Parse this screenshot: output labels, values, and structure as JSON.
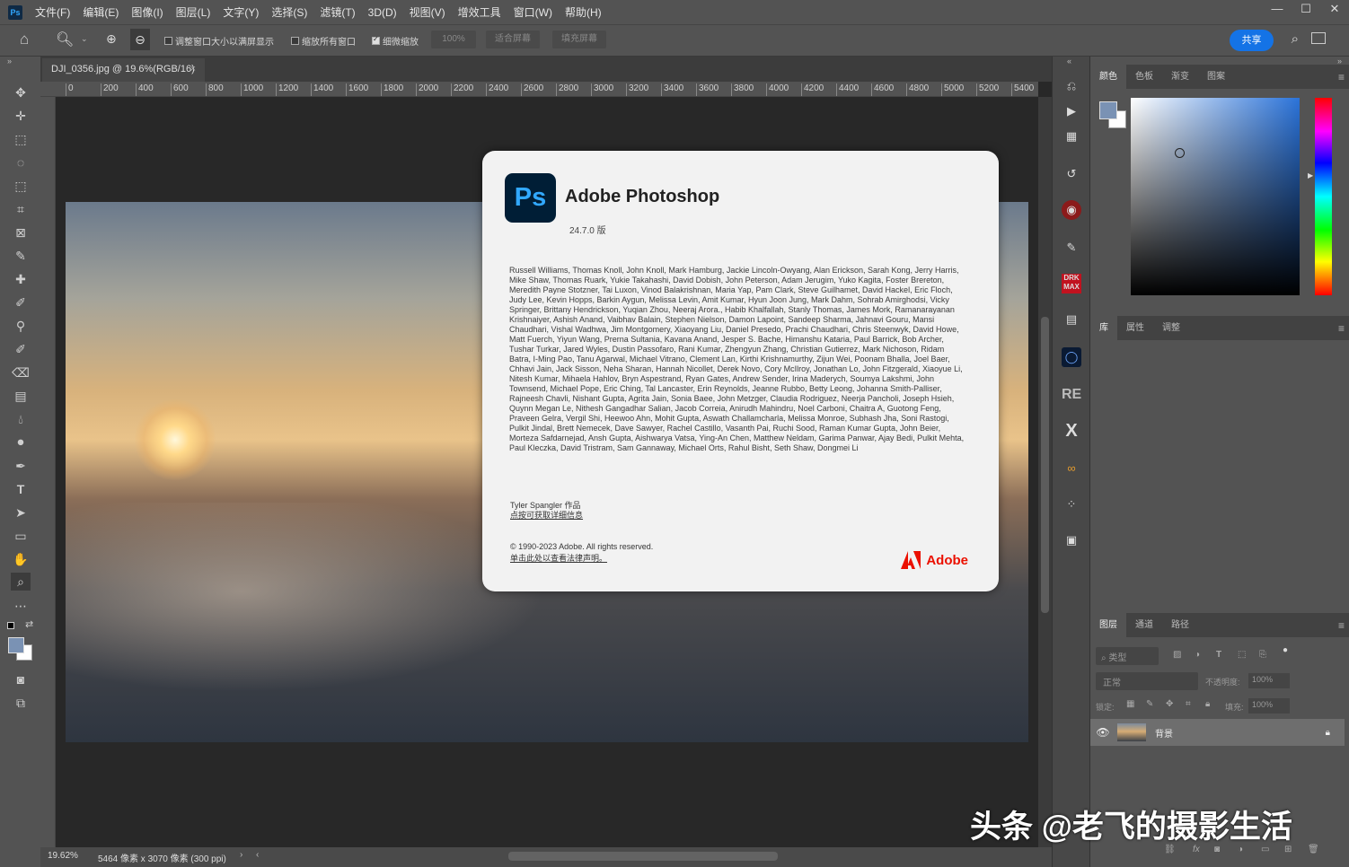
{
  "menubar": {
    "app_icon": "Ps",
    "items": [
      "文件(F)",
      "编辑(E)",
      "图像(I)",
      "图层(L)",
      "文字(Y)",
      "选择(S)",
      "滤镜(T)",
      "3D(D)",
      "视图(V)",
      "增效工具",
      "窗口(W)",
      "帮助(H)"
    ],
    "win_min": "—",
    "win_max": "☐",
    "win_close": "✕"
  },
  "options": {
    "fit_windows": "调整窗口大小以满屏显示",
    "zoom_all": "缩放所有窗口",
    "scrubby": "细微缩放",
    "zoom_value": "100%",
    "fit_screen": "适合屏幕",
    "fill_screen": "填充屏幕",
    "share": "共享"
  },
  "document": {
    "tab_title": "DJI_0356.jpg @ 19.6%(RGB/16)",
    "tab_close": "×",
    "zoom": "19.62%",
    "dimensions": "5464 像素 x 3070 像素 (300 ppi)",
    "ruler_labels": [
      "0",
      "200",
      "400",
      "600",
      "800",
      "1000",
      "1200",
      "1400",
      "1600",
      "1800",
      "2000",
      "2200",
      "2400",
      "2600",
      "2800",
      "3000",
      "3200",
      "3400",
      "3600",
      "3800",
      "4000",
      "4200",
      "4400",
      "4600",
      "4800",
      "5000",
      "5200",
      "5400"
    ]
  },
  "panels": {
    "color_tabs": [
      "颜色",
      "色板",
      "渐变",
      "图案"
    ],
    "lib_tabs": [
      "库",
      "属性",
      "调整"
    ],
    "layer_tabs": [
      "图层",
      "通道",
      "路径"
    ],
    "filter_kind": "类型",
    "blend_mode": "正常",
    "opacity_label": "不透明度:",
    "opacity_value": "100%",
    "lock_label": "锁定:",
    "fill_label": "填充:",
    "fill_value": "100%",
    "layer_name": "背景"
  },
  "about": {
    "title": "Adobe Photoshop",
    "version": "24.7.0 版",
    "credits": "Russell Williams, Thomas Knoll, John Knoll, Mark Hamburg, Jackie Lincoln-Owyang, Alan Erickson, Sarah Kong, Jerry Harris, Mike Shaw, Thomas Ruark, Yukie Takahashi, David Dobish, John Peterson, Adam Jerugim, Yuko Kagita, Foster Brereton, Meredith Payne Stotzner, Tai Luxon, Vinod Balakrishnan, Maria Yap, Pam Clark, Steve Guilhamet, David Hackel, Eric Floch, Judy Lee, Kevin Hopps, Barkin Aygun, Melissa Levin, Amit Kumar, Hyun Joon Jung, Mark Dahm, Sohrab Amirghodsi, Vicky Springer, Brittany Hendrickson, Yuqian Zhou, Neeraj Arora., Habib Khalfallah, Stanly Thomas, James Mork, Ramanarayanan Krishnaiyer, Ashish Anand, Vaibhav Balain, Stephen Nielson, Damon Lapoint, Sandeep Sharma, Jahnavi Gouru, Mansi Chaudhari, Vishal Wadhwa, Jim Montgomery, Xiaoyang Liu, Daniel Presedo, Prachi Chaudhari, Chris Steenwyk, David Howe, Matt Fuerch, Yiyun Wang, Prerna Sultania, Kavana Anand, Jesper S. Bache, Himanshu Kataria, Paul Barrick, Bob Archer, Tushar Turkar, Jared Wyles, Dustin Passofaro, Rani Kumar, Zhengyun Zhang, Christian Gutierrez, Mark Nichoson, Ridam Batra, I-Ming Pao, Tanu Agarwal, Michael Vitrano, Clement Lan, Kirthi Krishnamurthy, Zijun Wei, Poonam Bhalla, Joel Baer, Chhavi Jain, Jack Sisson, Neha Sharan, Hannah Nicollet, Derek Novo, Cory McIlroy, Jonathan Lo, John Fitzgerald, Xiaoyue Li, Nitesh Kumar, Mihaela Hahlov, Bryn Aspestrand, Ryan Gates, Andrew Sender, Irina Maderych, Soumya Lakshmi, John Townsend, Michael Pope, Eric Ching, Tal Lancaster, Erin Reynolds, Jeanne Rubbo, Betty Leong, Johanna Smith-Palliser, Rajneesh Chavli, Nishant Gupta, Agrita Jain, Sonia Baee, John Metzger, Claudia Rodriguez, Neerja Pancholi, Joseph Hsieh, Quynn Megan Le, Nithesh Gangadhar Salian, Jacob Correia, Anirudh Mahindru, Noel Carboni, Chaitra A, Guotong Feng, Praveen Gelra, Vergil Shi, Heewoo Ahn, Mohit Gupta, Aswath Challamcharla, Melissa Monroe, Subhash Jha, Soni Rastogi, Pulkit Jindal, Brett Nemecek, Dave Sawyer, Rachel Castillo, Vasanth Pai, Ruchi Sood, Raman Kumar Gupta, John Beier, Morteza Safdarnejad, Ansh Gupta, Aishwarya Vatsa, Ying-An Chen, Matthew Neldam, Garima Panwar, Ajay Bedi, Pulkit Mehta, Paul Kleczka, David Tristram, Sam Gannaway, Michael Orts, Rahul Bisht, Seth Shaw, Dongmei Li",
    "artwork": "Tyler Spangler 作品",
    "artwork_link": "点按可获取详细信息",
    "copyright": "© 1990-2023 Adobe. All rights reserved.",
    "legal_link": "单击此处以查看法律声明。",
    "adobe": "Adobe"
  },
  "watermark": "头条 @老飞的摄影生活",
  "colors": {
    "accent": "#1473e6",
    "adobe_red": "#eb1000",
    "ps_blue": "#31a8ff",
    "foreground_swatch": "#7a92b4"
  },
  "icons": [
    "home-icon",
    "zoom-icon",
    "zoom-in-icon",
    "zoom-out-icon",
    "search-icon",
    "workspace-icon",
    "move-icon",
    "marquee-icon",
    "lasso-icon",
    "crop-icon",
    "eyedropper-icon",
    "brush-icon",
    "eraser-icon",
    "gradient-icon",
    "pen-icon",
    "type-icon",
    "hand-icon",
    "eye-icon",
    "lock-icon"
  ]
}
